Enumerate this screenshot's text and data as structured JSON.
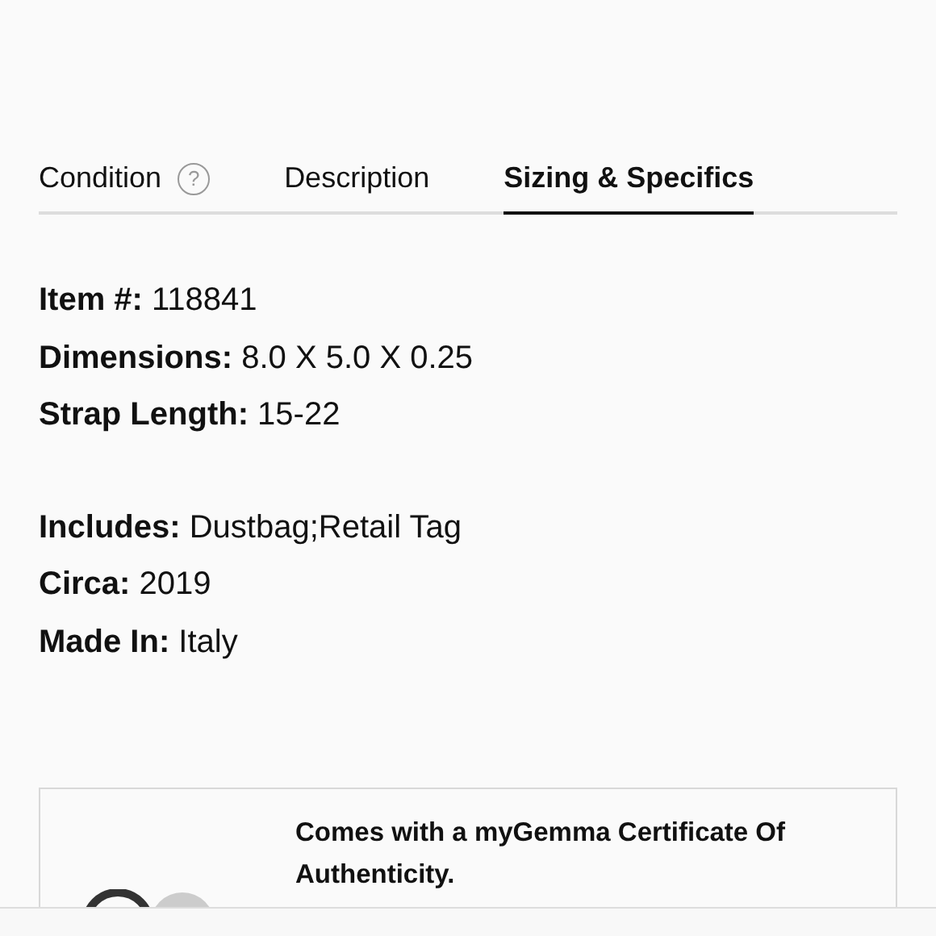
{
  "tabs": [
    {
      "label": "Condition",
      "help": "?",
      "selected": false
    },
    {
      "label": "Description",
      "selected": false
    },
    {
      "label": "Sizing & Specifics",
      "selected": true
    }
  ],
  "spec_groups": [
    [
      {
        "label": "Item #:",
        "value": "118841"
      },
      {
        "label": "Dimensions:",
        "value": "8.0 X 5.0 X 0.25"
      },
      {
        "label": "Strap Length:",
        "value": "15-22"
      }
    ],
    [
      {
        "label": "Includes:",
        "value": "Dustbag;Retail Tag"
      },
      {
        "label": "Circa:",
        "value": "2019"
      },
      {
        "label": "Made In:",
        "value": "Italy"
      }
    ]
  ],
  "certificate": {
    "text": "Comes with a myGemma Certificate Of Authenticity."
  }
}
